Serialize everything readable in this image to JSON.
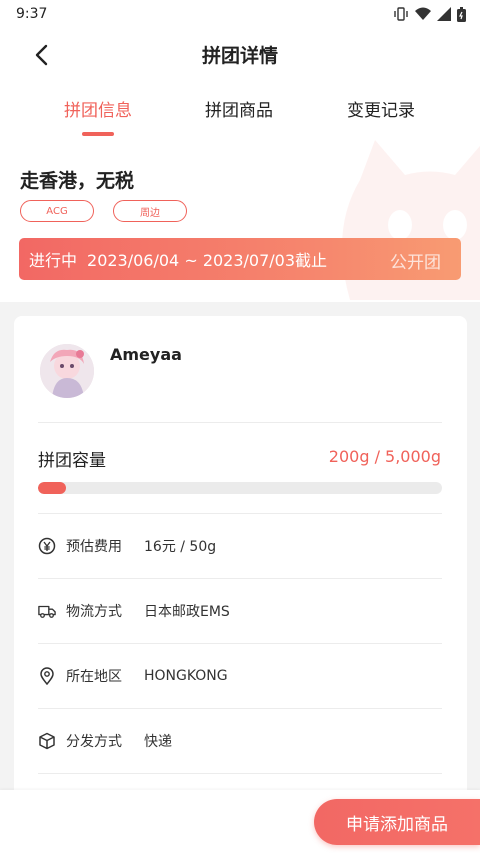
{
  "status_bar": {
    "time": "9:37"
  },
  "header": {
    "title": "拼团详情"
  },
  "tabs": [
    {
      "label": "拼团信息",
      "active": true
    },
    {
      "label": "拼团商品",
      "active": false
    },
    {
      "label": "变更记录",
      "active": false
    }
  ],
  "group": {
    "name": "走香港，无税",
    "tags": [
      "ACG",
      "周边"
    ],
    "status": "进行中",
    "period": "2023/06/04 ~ 2023/07/03截止",
    "visibility": "公开团"
  },
  "organizer": {
    "name": "Ameyaa"
  },
  "capacity": {
    "label": "拼团容量",
    "value": "200g / 5,000g",
    "fill_fraction": 0.04
  },
  "details": [
    {
      "icon": "yen-icon",
      "label": "预估费用",
      "value": "16元 / 50g"
    },
    {
      "icon": "truck-icon",
      "label": "物流方式",
      "value": "日本邮政EMS"
    },
    {
      "icon": "location-pin-icon",
      "label": "所在地区",
      "value": "HONGKONG"
    },
    {
      "icon": "box-icon",
      "label": "分发方式",
      "value": "快递"
    }
  ],
  "actions": {
    "apply_label": "申请添加商品"
  },
  "colors": {
    "accent": "#f0625a"
  }
}
